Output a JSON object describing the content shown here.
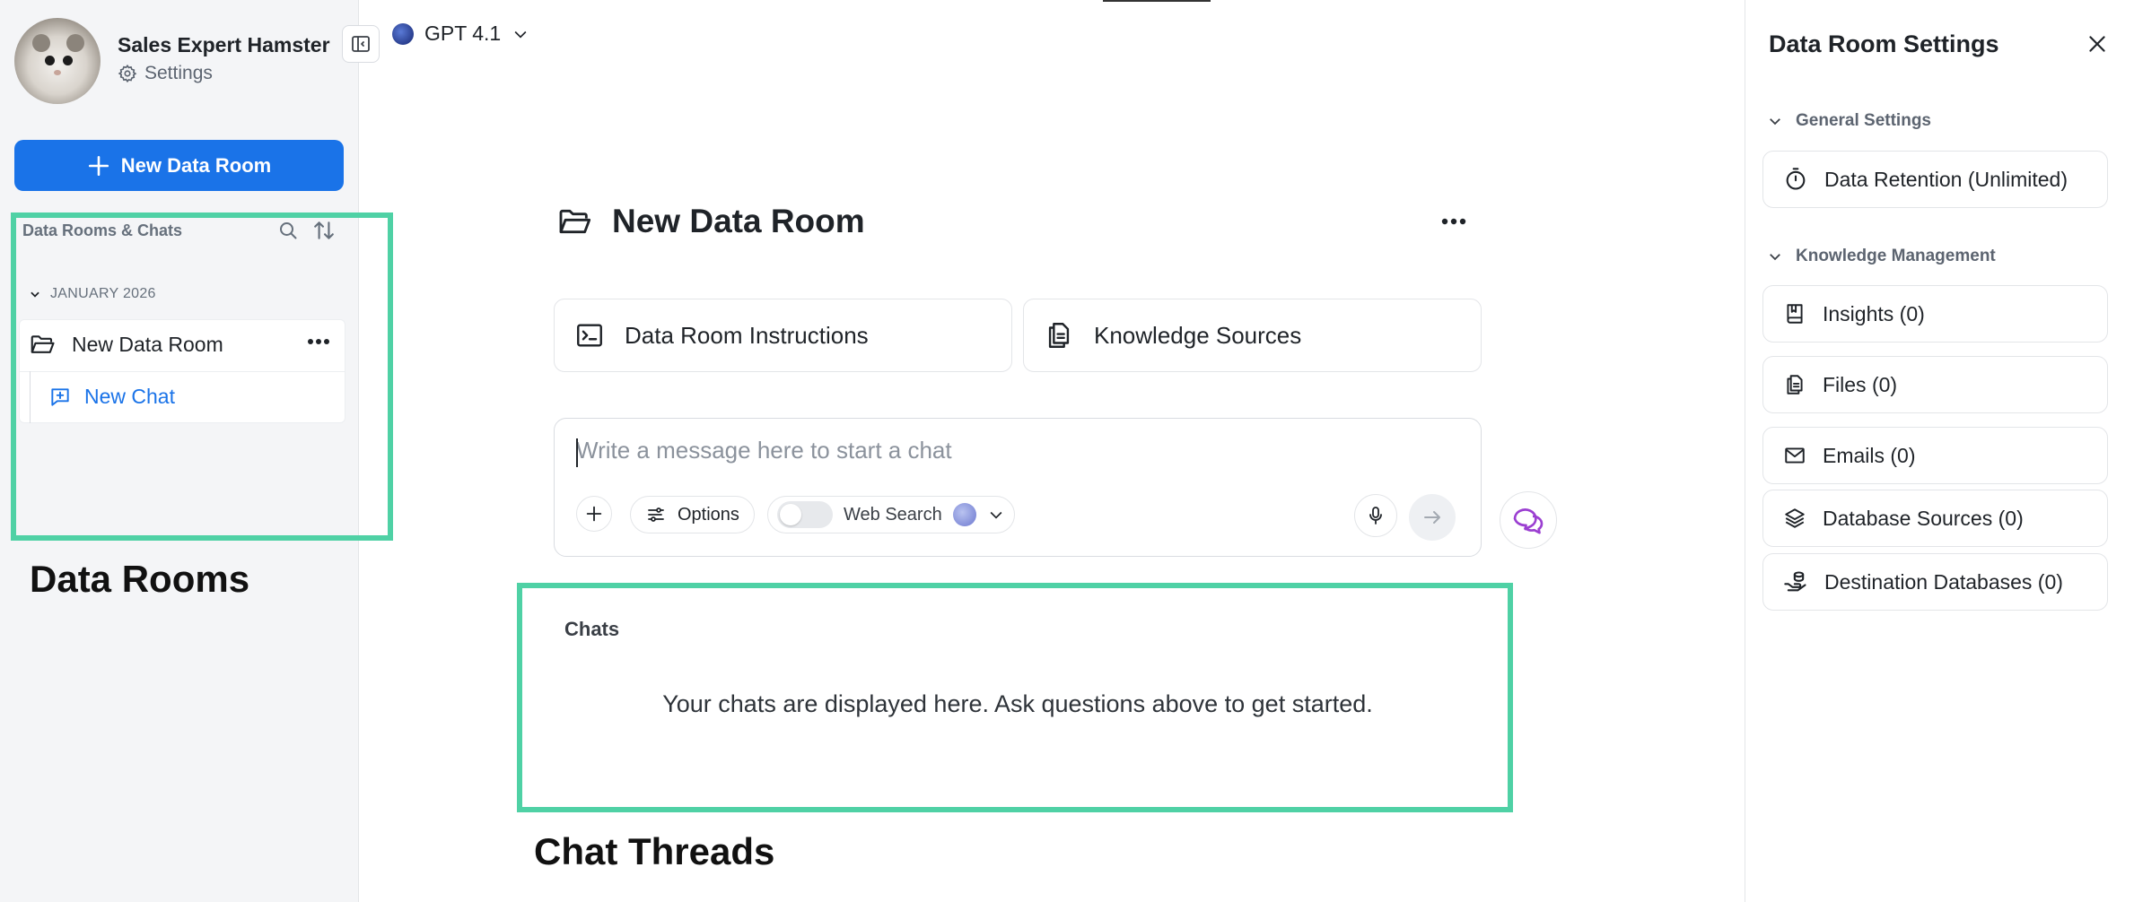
{
  "user": {
    "name": "Sales Expert Hamster",
    "settings_label": "Settings"
  },
  "sidebar": {
    "new_room_label": "New Data Room",
    "section_title": "Data Rooms & Chats",
    "month_group": "JANUARY 2026",
    "rooms": [
      {
        "name": "New Data Room",
        "chats": [
          {
            "label": "New Chat"
          }
        ]
      }
    ]
  },
  "model": {
    "name": "GPT 4.1"
  },
  "main": {
    "room_title": "New Data Room",
    "cards": {
      "instructions": "Data Room Instructions",
      "knowledge": "Knowledge Sources"
    },
    "composer": {
      "placeholder": "Write a message here to start a chat",
      "options_label": "Options",
      "web_search_label": "Web Search"
    },
    "chats": {
      "heading": "Chats",
      "empty_text": "Your chats are displayed here. Ask questions above to get started."
    }
  },
  "annotations": {
    "rooms_label": "Data Rooms",
    "chats_label": "Chat Threads",
    "highlight_color": "#4fd1a5"
  },
  "settings_panel": {
    "title": "Data Room Settings",
    "general_section": "General Settings",
    "general_items": [
      {
        "label": "Data Retention (Unlimited)",
        "icon": "timer-icon"
      }
    ],
    "knowledge_section": "Knowledge Management",
    "knowledge_items": [
      {
        "label": "Insights (0)",
        "icon": "bookmark-book-icon"
      },
      {
        "label": "Files (0)",
        "icon": "file-icon"
      },
      {
        "label": "Emails (0)",
        "icon": "mail-icon"
      },
      {
        "label": "Database Sources (0)",
        "icon": "layers-icon"
      },
      {
        "label": "Destination Databases (0)",
        "icon": "hand-database-icon"
      }
    ]
  },
  "colors": {
    "accent": "#1a73e8",
    "chat_icon": "#9b3fd1"
  }
}
